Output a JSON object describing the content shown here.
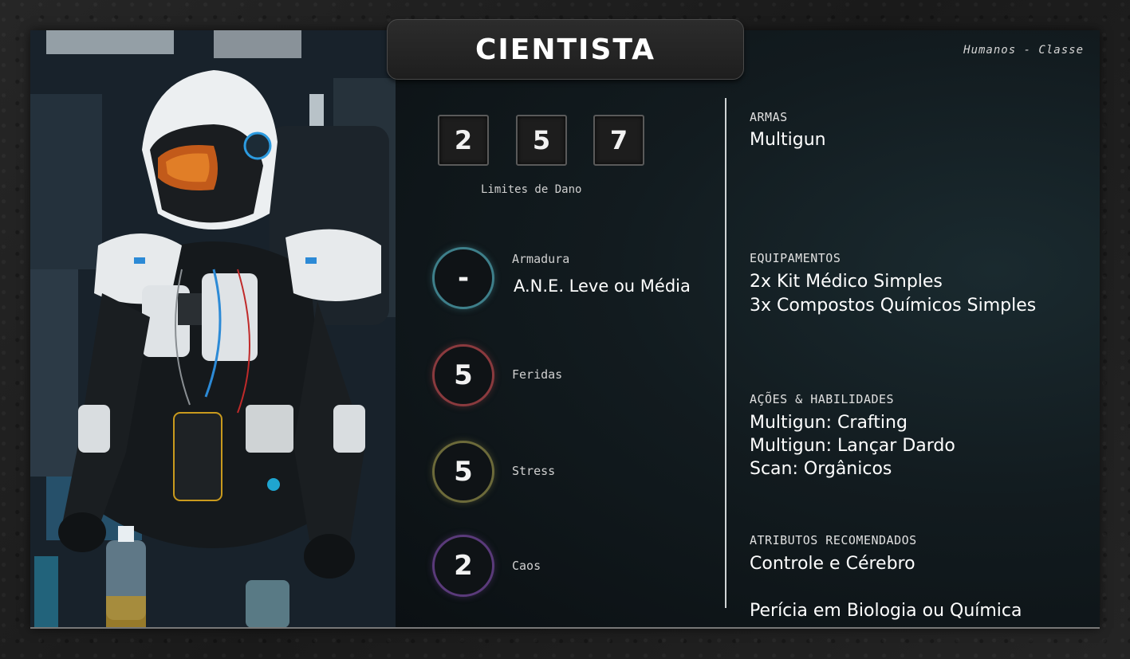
{
  "header": {
    "title": "CIENTISTA",
    "subtitle": "Humanos - Classe"
  },
  "damage_limits": {
    "values": [
      "2",
      "5",
      "7"
    ],
    "label": "Limites de Dano"
  },
  "stats": {
    "armor": {
      "value": "-",
      "label": "Armadura",
      "detail": "A.N.E. Leve ou Média",
      "color": "#3e7f8a"
    },
    "wounds": {
      "value": "5",
      "label": "Feridas",
      "color": "#8a3a3e"
    },
    "stress": {
      "value": "5",
      "label": "Stress",
      "color": "#6c6a3a"
    },
    "chaos": {
      "value": "2",
      "label": "Caos",
      "color": "#5a3a7a"
    }
  },
  "sections": {
    "weapons": {
      "heading": "ARMAS",
      "lines": [
        "Multigun"
      ]
    },
    "equipment": {
      "heading": "EQUIPAMENTOS",
      "lines": [
        "2x Kit Médico Simples",
        "3x Compostos Químicos Simples"
      ]
    },
    "actions": {
      "heading": "AÇÕES & HABILIDADES",
      "lines": [
        "Multigun: Crafting",
        "Multigun: Lançar Dardo",
        "Scan: Orgânicos"
      ]
    },
    "attributes": {
      "heading": "ATRIBUTOS RECOMENDADOS",
      "lines": [
        "Controle e Cérebro",
        "",
        "Perícia em Biologia ou Química"
      ]
    }
  }
}
